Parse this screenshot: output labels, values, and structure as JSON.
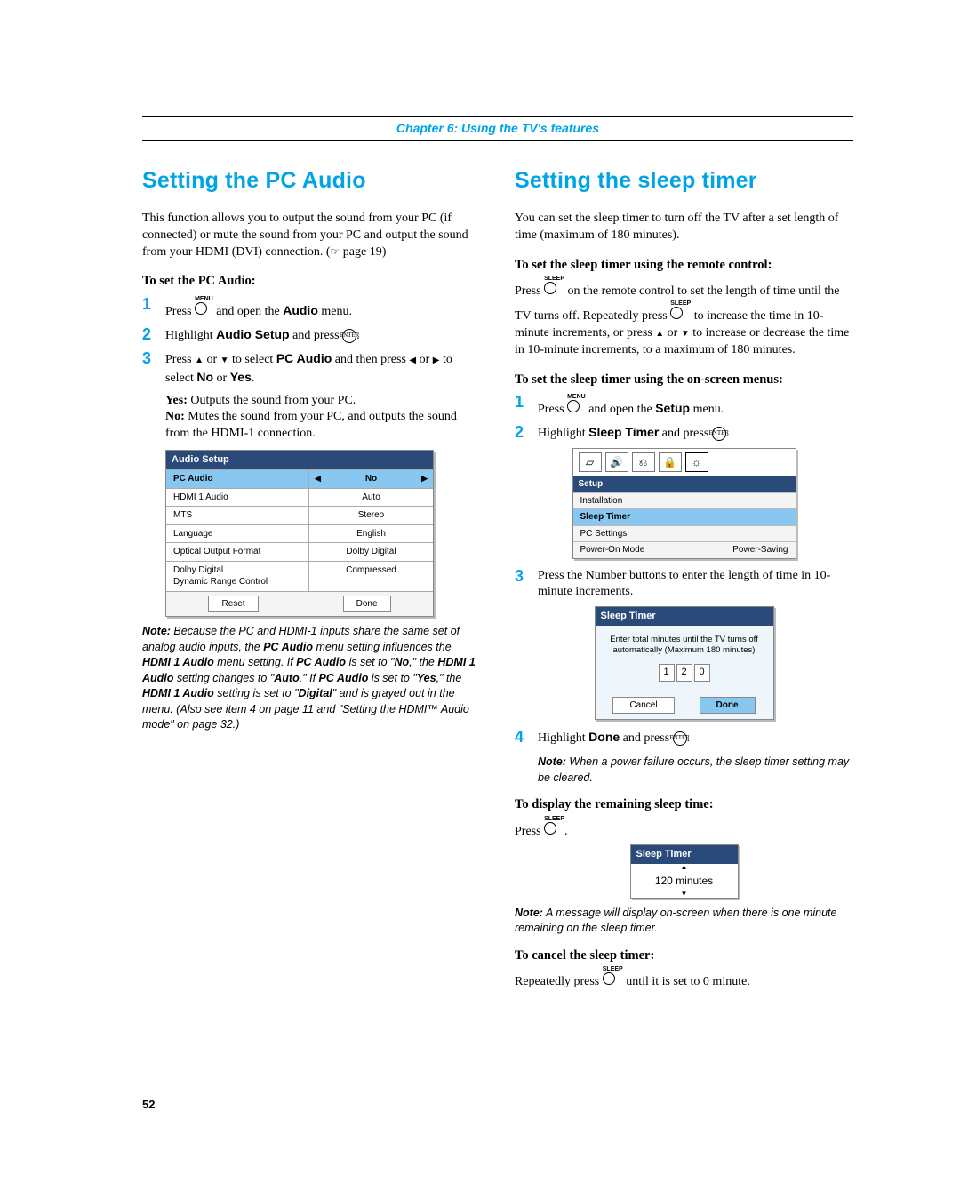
{
  "header": {
    "chapter": "Chapter 6: Using the TV's features"
  },
  "left": {
    "h1": "Setting the PC Audio",
    "intro": "This function allows you to output the sound from your PC (if connected) or mute the sound from your PC and output the sound from your HDMI (DVI) connection. (",
    "intro_ref": " page 19)",
    "sub1": "To set the PC Audio:",
    "step1_a": "Press ",
    "step1_menu": "MENU",
    "step1_b": " and open the ",
    "step1_audio": "Audio",
    "step1_c": " menu.",
    "step2_a": "Highlight ",
    "step2_b": "Audio Setup",
    "step2_c": " and press ",
    "step2_enter": "ENTER",
    "step3_a": "Press ",
    "step3_b": " or ",
    "step3_c": " to select ",
    "step3_pc": "PC Audio",
    "step3_d": " and then press ",
    "step3_e": " or ",
    "step3_f": " to select ",
    "step3_no": "No",
    "step3_or": " or ",
    "step3_yes": "Yes",
    "yes_lbl": "Yes:",
    "yes_txt": " Outputs the sound from your PC.",
    "no_lbl": "No:",
    "no_txt": " Mutes the sound from your PC, and outputs the sound from the HDMI-1 connection.",
    "osd": {
      "title": "Audio Setup",
      "rows": [
        {
          "l": "PC Audio",
          "r": "No",
          "hl": true,
          "arrows": true
        },
        {
          "l": "HDMI 1 Audio",
          "r": "Auto"
        },
        {
          "l": "MTS",
          "r": "Stereo"
        },
        {
          "l": "Language",
          "r": "English"
        },
        {
          "l": "Optical Output Format",
          "r": "Dolby Digital"
        },
        {
          "l": "Dolby Digital\nDynamic Range Control",
          "r": "Compressed"
        }
      ],
      "btn_reset": "Reset",
      "btn_done": "Done"
    },
    "note_lbl": "Note:",
    "note_txt_a": " Because the PC and HDMI-1 inputs share the same set of analog audio inputs, the ",
    "note_pc": "PC Audio",
    "note_txt_b": " menu setting influences the ",
    "note_h1a": "HDMI 1 Audio",
    "note_txt_c": " menu setting. If ",
    "note_pc2": "PC Audio",
    "note_txt_d": " is set to \"",
    "note_no": "No",
    "note_txt_e": ",\" the ",
    "note_h1a2": "HDMI 1 Audio",
    "note_txt_f": " setting changes to \"",
    "note_auto": "Auto",
    "note_txt_g": ".\" If ",
    "note_pc3": "PC Audio",
    "note_txt_h": " is set to \"",
    "note_yes": "Yes",
    "note_txt_i": ",\" the ",
    "note_h1a3": "HDMI 1 Audio",
    "note_txt_j": " setting is set to \"",
    "note_dig": "Digital",
    "note_txt_k": "\" and is grayed out in the menu. (Also see item 4 on page 11 and \"Setting the HDMI™ Audio mode\" on page 32.)"
  },
  "right": {
    "h1": "Setting the sleep timer",
    "intro": "You can set the sleep timer to turn off the TV after a set length of time (maximum of 180 minutes).",
    "sub1": "To set the sleep timer using the remote control:",
    "para1_a": "Press ",
    "para1_sleep": "SLEEP",
    "para1_b": " on the remote control to set the length of time until the TV turns off. Repeatedly press ",
    "para1_c": " to increase the time in 10-minute increments, or press ",
    "para1_d": " or ",
    "para1_e": " to increase or decrease the time in 10-minute increments, to a maximum of 180 minutes.",
    "sub2": "To set the sleep timer using the on-screen menus:",
    "step1_a": "Press ",
    "step1_menu": "MENU",
    "step1_b": " and open the ",
    "step1_setup": "Setup",
    "step1_c": " menu.",
    "step2_a": "Highlight ",
    "step2_b": "Sleep Timer",
    "step2_c": " and press ",
    "step2_enter": "ENTER",
    "osd_setup": {
      "title": "Setup",
      "rows": [
        {
          "l": "Installation"
        },
        {
          "l": "Sleep Timer",
          "hl": true
        },
        {
          "l": "PC Settings"
        },
        {
          "l": "Power-On Mode",
          "r": "Power-Saving"
        }
      ]
    },
    "step3_txt": "Press the Number buttons to enter the length of time in 10-minute increments.",
    "osd_sleep": {
      "title": "Sleep Timer",
      "msg": "Enter total minutes until the TV turns off automatically (Maximum 180 minutes)",
      "d1": "1",
      "d2": "2",
      "d3": "0",
      "cancel": "Cancel",
      "done": "Done"
    },
    "step4_a": "Highlight ",
    "step4_b": "Done",
    "step4_c": " and press ",
    "step4_enter": "ENTER",
    "note1_lbl": "Note:",
    "note1_txt": " When a power failure occurs, the sleep timer setting may be cleared.",
    "sub3": "To display the remaining sleep time:",
    "disp_a": "Press ",
    "disp_sleep": "SLEEP",
    "osd_mini": {
      "title": "Sleep Timer",
      "val": "120 minutes"
    },
    "note2_lbl": "Note:",
    "note2_txt": " A message will display on-screen when there is one minute remaining on the sleep timer.",
    "sub4": "To cancel the sleep timer:",
    "cancel_a": "Repeatedly press ",
    "cancel_sleep": "SLEEP",
    "cancel_b": " until it is set to 0 minute."
  },
  "pagenum": "52"
}
